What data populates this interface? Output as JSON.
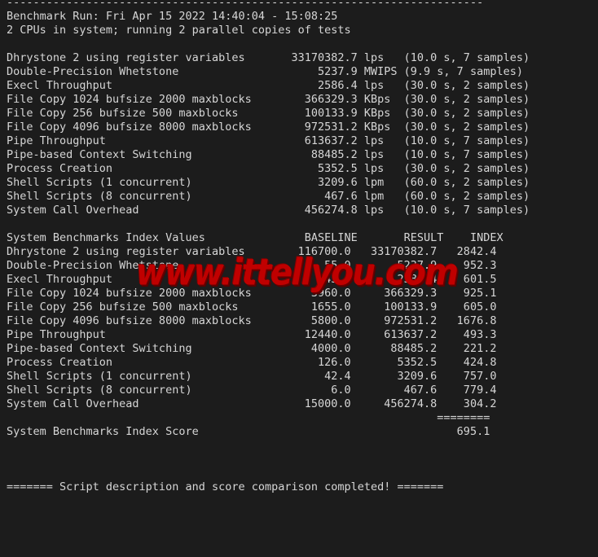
{
  "terminal": {
    "background_color": "#1c1c1c",
    "text_color": "#d6d6d6",
    "watermark": {
      "text": "www.ittellyou.com",
      "color": "#c00000"
    },
    "lines": [
      "------------------------------------------------------------------------",
      "Benchmark Run: Fri Apr 15 2022 14:40:04 - 15:08:25",
      "2 CPUs in system; running 2 parallel copies of tests",
      "",
      "Dhrystone 2 using register variables       33170382.7 lps   (10.0 s, 7 samples)",
      "Double-Precision Whetstone                     5237.9 MWIPS (9.9 s, 7 samples)",
      "Execl Throughput                               2586.4 lps   (30.0 s, 2 samples)",
      "File Copy 1024 bufsize 2000 maxblocks        366329.3 KBps  (30.0 s, 2 samples)",
      "File Copy 256 bufsize 500 maxblocks          100133.9 KBps  (30.0 s, 2 samples)",
      "File Copy 4096 bufsize 8000 maxblocks        972531.2 KBps  (30.0 s, 2 samples)",
      "Pipe Throughput                              613637.2 lps   (10.0 s, 7 samples)",
      "Pipe-based Context Switching                  88485.2 lps   (10.0 s, 7 samples)",
      "Process Creation                               5352.5 lps   (30.0 s, 2 samples)",
      "Shell Scripts (1 concurrent)                   3209.6 lpm   (60.0 s, 2 samples)",
      "Shell Scripts (8 concurrent)                    467.6 lpm   (60.0 s, 2 samples)",
      "System Call Overhead                         456274.8 lps   (10.0 s, 7 samples)",
      "",
      "System Benchmarks Index Values               BASELINE       RESULT    INDEX",
      "Dhrystone 2 using register variables        116700.0   33170382.7   2842.4",
      "Double-Precision Whetstone                      55.0       5237.9    952.3",
      "Execl Throughput                                43.0       2586.4    601.5",
      "File Copy 1024 bufsize 2000 maxblocks         3960.0     366329.3    925.1",
      "File Copy 256 bufsize 500 maxblocks           1655.0     100133.9    605.0",
      "File Copy 4096 bufsize 8000 maxblocks         5800.0     972531.2   1676.8",
      "Pipe Throughput                              12440.0     613637.2    493.3",
      "Pipe-based Context Switching                  4000.0      88485.2    221.2",
      "Process Creation                               126.0       5352.5    424.8",
      "Shell Scripts (1 concurrent)                    42.4       3209.6    757.0",
      "Shell Scripts (8 concurrent)                     6.0        467.6    779.4",
      "System Call Overhead                         15000.0     456274.8    304.2",
      "                                                                 ========",
      "System Benchmarks Index Score                                       695.1",
      "",
      "",
      "",
      "======= Script description and score comparison completed! ======="
    ]
  },
  "benchmark_run": {
    "header_separator": "------------------------------------------------------------------------",
    "run_label": "Benchmark Run:",
    "date": "Fri Apr 15 2022",
    "start_time": "14:40:04",
    "end_time": "15:08:25",
    "cpu_info": "2 CPUs in system; running 2 parallel copies of tests"
  },
  "raw_results": {
    "columns": [
      "test",
      "value",
      "unit",
      "timing"
    ],
    "rows": [
      {
        "test": "Dhrystone 2 using register variables",
        "value": "33170382.7",
        "unit": "lps",
        "timing": "(10.0 s, 7 samples)"
      },
      {
        "test": "Double-Precision Whetstone",
        "value": "5237.9",
        "unit": "MWIPS",
        "timing": "(9.9 s, 7 samples)"
      },
      {
        "test": "Execl Throughput",
        "value": "2586.4",
        "unit": "lps",
        "timing": "(30.0 s, 2 samples)"
      },
      {
        "test": "File Copy 1024 bufsize 2000 maxblocks",
        "value": "366329.3",
        "unit": "KBps",
        "timing": "(30.0 s, 2 samples)"
      },
      {
        "test": "File Copy 256 bufsize 500 maxblocks",
        "value": "100133.9",
        "unit": "KBps",
        "timing": "(30.0 s, 2 samples)"
      },
      {
        "test": "File Copy 4096 bufsize 8000 maxblocks",
        "value": "972531.2",
        "unit": "KBps",
        "timing": "(30.0 s, 2 samples)"
      },
      {
        "test": "Pipe Throughput",
        "value": "613637.2",
        "unit": "lps",
        "timing": "(10.0 s, 7 samples)"
      },
      {
        "test": "Pipe-based Context Switching",
        "value": "88485.2",
        "unit": "lps",
        "timing": "(10.0 s, 7 samples)"
      },
      {
        "test": "Process Creation",
        "value": "5352.5",
        "unit": "lps",
        "timing": "(30.0 s, 2 samples)"
      },
      {
        "test": "Shell Scripts (1 concurrent)",
        "value": "3209.6",
        "unit": "lpm",
        "timing": "(60.0 s, 2 samples)"
      },
      {
        "test": "Shell Scripts (8 concurrent)",
        "value": "467.6",
        "unit": "lpm",
        "timing": "(60.0 s, 2 samples)"
      },
      {
        "test": "System Call Overhead",
        "value": "456274.8",
        "unit": "lps",
        "timing": "(10.0 s, 7 samples)"
      }
    ]
  },
  "index_values": {
    "section_title": "System Benchmarks Index Values",
    "headers": [
      "BASELINE",
      "RESULT",
      "INDEX"
    ],
    "rows": [
      {
        "test": "Dhrystone 2 using register variables",
        "baseline": "116700.0",
        "result": "33170382.7",
        "index": "2842.4"
      },
      {
        "test": "Double-Precision Whetstone",
        "baseline": "55.0",
        "result": "5237.9",
        "index": "952.3"
      },
      {
        "test": "Execl Throughput",
        "baseline": "43.0",
        "result": "2586.4",
        "index": "601.5"
      },
      {
        "test": "File Copy 1024 bufsize 2000 maxblocks",
        "baseline": "3960.0",
        "result": "366329.3",
        "index": "925.1"
      },
      {
        "test": "File Copy 256 bufsize 500 maxblocks",
        "baseline": "1655.0",
        "result": "100133.9",
        "index": "605.0"
      },
      {
        "test": "File Copy 4096 bufsize 8000 maxblocks",
        "baseline": "5800.0",
        "result": "972531.2",
        "index": "1676.8"
      },
      {
        "test": "Pipe Throughput",
        "baseline": "12440.0",
        "result": "613637.2",
        "index": "493.3"
      },
      {
        "test": "Pipe-based Context Switching",
        "baseline": "4000.0",
        "result": "88485.2",
        "index": "221.2"
      },
      {
        "test": "Process Creation",
        "baseline": "126.0",
        "result": "5352.5",
        "index": "424.8"
      },
      {
        "test": "Shell Scripts (1 concurrent)",
        "baseline": "42.4",
        "result": "3209.6",
        "index": "757.0"
      },
      {
        "test": "Shell Scripts (8 concurrent)",
        "baseline": "6.0",
        "result": "467.6",
        "index": "779.4"
      },
      {
        "test": "System Call Overhead",
        "baseline": "15000.0",
        "result": "456274.8",
        "index": "304.2"
      }
    ],
    "score_separator": "========",
    "score_label": "System Benchmarks Index Score",
    "score_value": "695.1"
  },
  "footer": {
    "completion_message": "======= Script description and score comparison completed! ======="
  }
}
